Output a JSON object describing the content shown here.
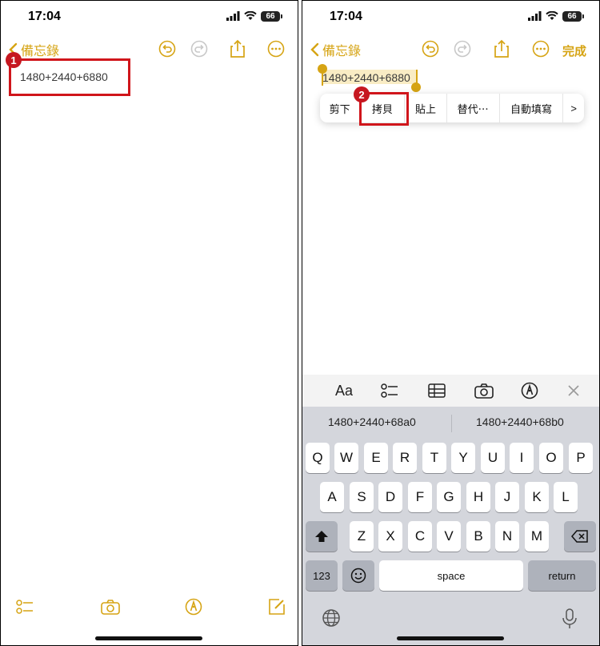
{
  "left": {
    "status_time": "17:04",
    "battery": "66",
    "back_label": "備忘錄",
    "note_text": "1480+2440+6880",
    "step_badge": "1"
  },
  "right": {
    "status_time": "17:04",
    "battery": "66",
    "back_label": "備忘錄",
    "done_label": "完成",
    "note_text": "1480+2440+6880",
    "step_badge": "2",
    "context_menu": [
      "剪下",
      "拷貝",
      "貼上",
      "替代⋯",
      "自動填寫",
      ">"
    ],
    "keyboard_toolbar": {
      "format": "Aa"
    },
    "suggestions": [
      "1480+2440+68a0",
      "1480+2440+68b0"
    ],
    "rows": [
      [
        "Q",
        "W",
        "E",
        "R",
        "T",
        "Y",
        "U",
        "I",
        "O",
        "P"
      ],
      [
        "A",
        "S",
        "D",
        "F",
        "G",
        "H",
        "J",
        "K",
        "L"
      ],
      [
        "Z",
        "X",
        "C",
        "V",
        "B",
        "N",
        "M"
      ]
    ],
    "key_123": "123",
    "key_space": "space",
    "key_return": "return"
  },
  "colors": {
    "accent": "#d6a414",
    "highlight": "#c61720"
  }
}
